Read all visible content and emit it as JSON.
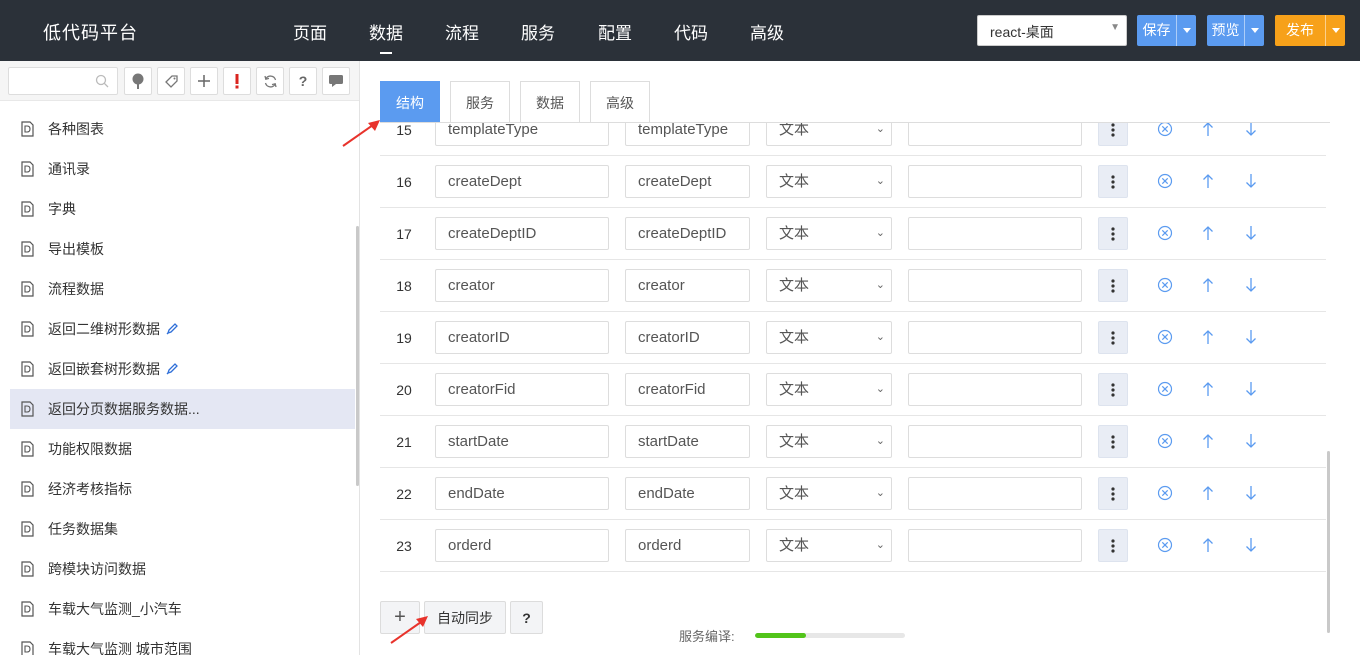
{
  "header": {
    "brand": "低代码平台",
    "nav": [
      "页面",
      "数据",
      "流程",
      "服务",
      "配置",
      "代码",
      "高级"
    ],
    "active_nav": 1,
    "platform": "react-桌面",
    "save_label": "保存",
    "preview_label": "预览",
    "publish_label": "发布"
  },
  "sidebar": {
    "search_placeholder": "",
    "items": [
      {
        "label": "各种图表",
        "pencil": false,
        "selected": false
      },
      {
        "label": "通讯录",
        "pencil": false,
        "selected": false
      },
      {
        "label": "字典",
        "pencil": false,
        "selected": false
      },
      {
        "label": "导出模板",
        "pencil": false,
        "selected": false
      },
      {
        "label": "流程数据",
        "pencil": false,
        "selected": false
      },
      {
        "label": "返回二维树形数据",
        "pencil": true,
        "selected": false
      },
      {
        "label": "返回嵌套树形数据",
        "pencil": true,
        "selected": false
      },
      {
        "label": "返回分页数据服务数据...",
        "pencil": false,
        "selected": true
      },
      {
        "label": "功能权限数据",
        "pencil": false,
        "selected": false
      },
      {
        "label": "经济考核指标",
        "pencil": false,
        "selected": false
      },
      {
        "label": "任务数据集",
        "pencil": false,
        "selected": false
      },
      {
        "label": "跨模块访问数据",
        "pencil": false,
        "selected": false
      },
      {
        "label": "车载大气监测_小汽车",
        "pencil": false,
        "selected": false
      },
      {
        "label": "车载大气监测 城市范围",
        "pencil": false,
        "selected": false
      }
    ]
  },
  "tabs": [
    "结构",
    "服务",
    "数据",
    "高级"
  ],
  "active_tab": 0,
  "rows": [
    {
      "num": "15",
      "name": "templateType",
      "label": "templateType",
      "type": "文本",
      "extra": ""
    },
    {
      "num": "16",
      "name": "createDept",
      "label": "createDept",
      "type": "文本",
      "extra": ""
    },
    {
      "num": "17",
      "name": "createDeptID",
      "label": "createDeptID",
      "type": "文本",
      "extra": ""
    },
    {
      "num": "18",
      "name": "creator",
      "label": "creator",
      "type": "文本",
      "extra": ""
    },
    {
      "num": "19",
      "name": "creatorID",
      "label": "creatorID",
      "type": "文本",
      "extra": ""
    },
    {
      "num": "20",
      "name": "creatorFid",
      "label": "creatorFid",
      "type": "文本",
      "extra": ""
    },
    {
      "num": "21",
      "name": "startDate",
      "label": "startDate",
      "type": "文本",
      "extra": ""
    },
    {
      "num": "22",
      "name": "endDate",
      "label": "endDate",
      "type": "文本",
      "extra": ""
    },
    {
      "num": "23",
      "name": "orderd",
      "label": "orderd",
      "type": "文本",
      "extra": ""
    }
  ],
  "bottom": {
    "add_label": "+",
    "sync_label": "自动同步",
    "help_label": "?",
    "compile_label": "服务编译:",
    "compile_progress": 0.34
  },
  "colors": {
    "header_bg": "#2b3139",
    "accent": "#5b9bf0",
    "publish": "#f7a11a",
    "annotation_arrow": "#e8332c",
    "progress": "#52c41a"
  }
}
